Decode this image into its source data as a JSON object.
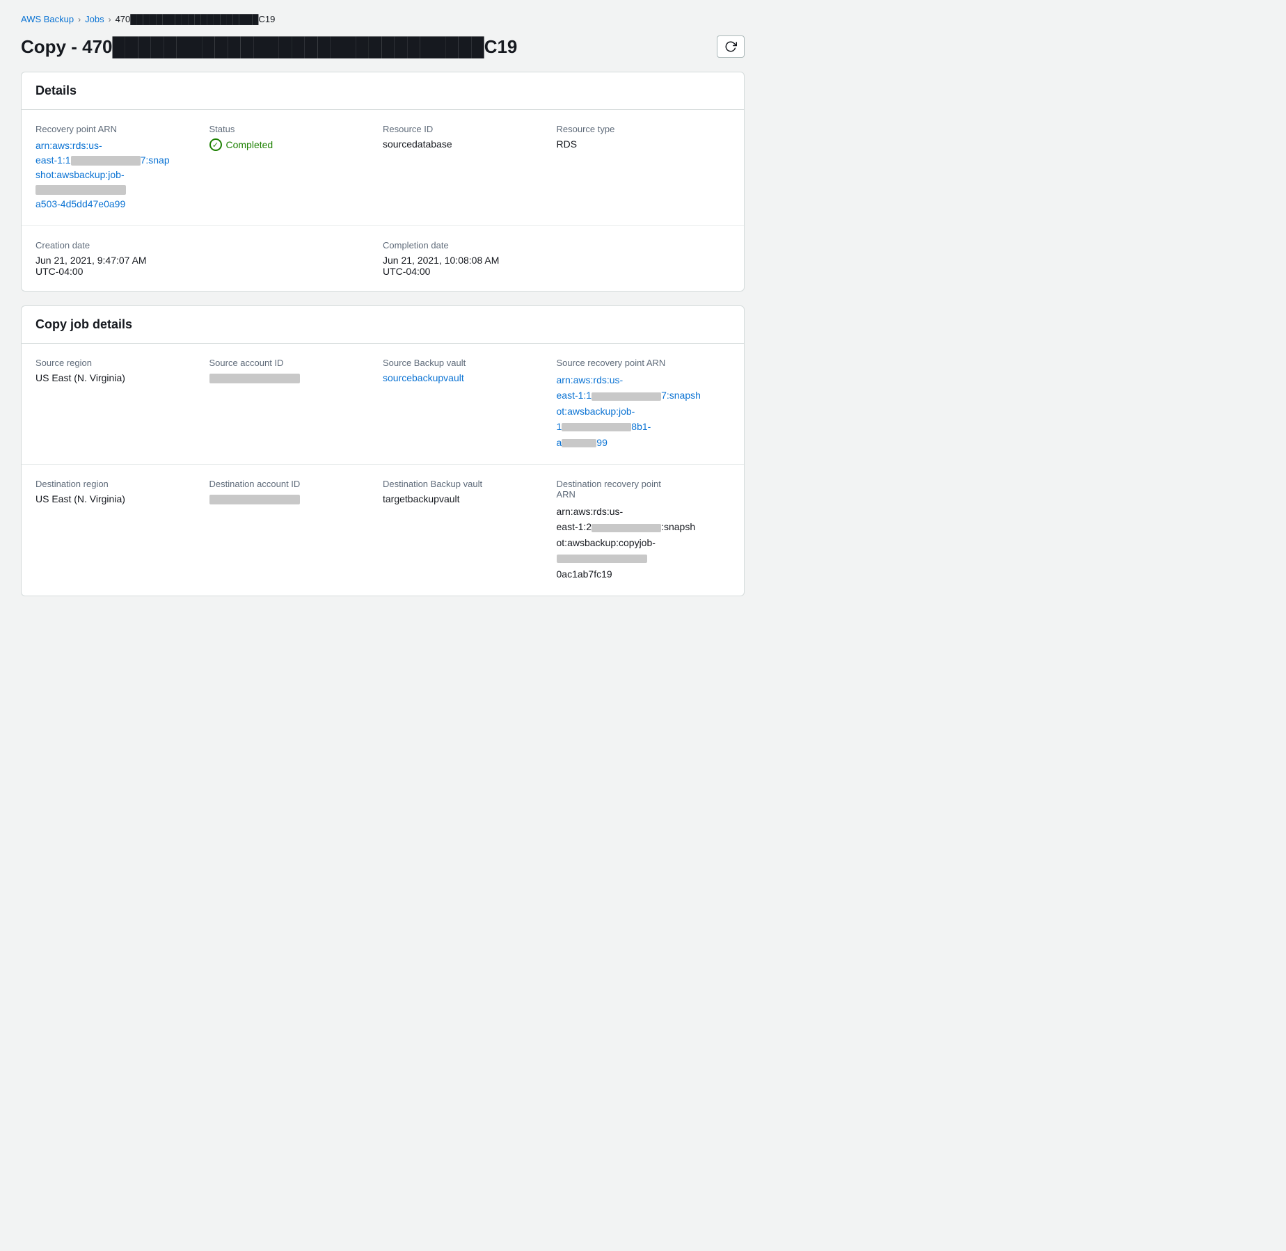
{
  "breadcrumb": {
    "items": [
      {
        "label": "AWS Backup",
        "isCurrent": false
      },
      {
        "label": "Jobs",
        "isCurrent": false
      },
      {
        "label": "470████████████████████C19",
        "isCurrent": true
      }
    ],
    "separators": [
      "›",
      "›"
    ]
  },
  "page": {
    "title": "Copy - 470█████████████████████████████C19",
    "refresh_button_label": "↻"
  },
  "details_card": {
    "title": "Details",
    "row1": {
      "recovery_point_arn_label": "Recovery point ARN",
      "recovery_point_arn_value": "arn:aws:rds:us-east-1:1██████7:snapshot:awsbackup:job-████ ████ ████a503-4d5dd47e0a99",
      "status_label": "Status",
      "status_value": "Completed",
      "resource_id_label": "Resource ID",
      "resource_id_value": "sourcedatabase",
      "resource_type_label": "Resource type",
      "resource_type_value": "RDS"
    },
    "row2": {
      "creation_date_label": "Creation date",
      "creation_date_value": "Jun 21, 2021, 9:47:07 AM",
      "creation_date_tz": "UTC-04:00",
      "completion_date_label": "Completion date",
      "completion_date_value": "Jun 21, 2021, 10:08:08 AM",
      "completion_date_tz": "UTC-04:00"
    }
  },
  "copy_job_details_card": {
    "title": "Copy job details",
    "row1": {
      "source_region_label": "Source region",
      "source_region_value": "US East (N. Virginia)",
      "source_account_id_label": "Source account ID",
      "source_account_id_value": "████████████",
      "source_backup_vault_label": "Source Backup vault",
      "source_backup_vault_value": "sourcebackupvault",
      "source_recovery_point_arn_label": "Source recovery point ARN",
      "source_recovery_point_arn_value": "arn:aws:rds:us-east-1:1██████████7:snapshot:awsbackup:job-1████████████8b1-a████████99"
    },
    "row2": {
      "destination_region_label": "Destination region",
      "destination_region_value": "US East (N. Virginia)",
      "destination_account_id_label": "Destination account ID",
      "destination_account_id_value": "████████████",
      "destination_backup_vault_label": "Destination Backup vault",
      "destination_backup_vault_value": "targetbackupvault",
      "destination_recovery_point_arn_label": "Destination recovery point ARN",
      "destination_recovery_point_arn_value": "arn:aws:rds:us-east-1:2██████████:snapshot:awsbackup:copyjob-████████████████████0ac1ab7fc19"
    }
  }
}
